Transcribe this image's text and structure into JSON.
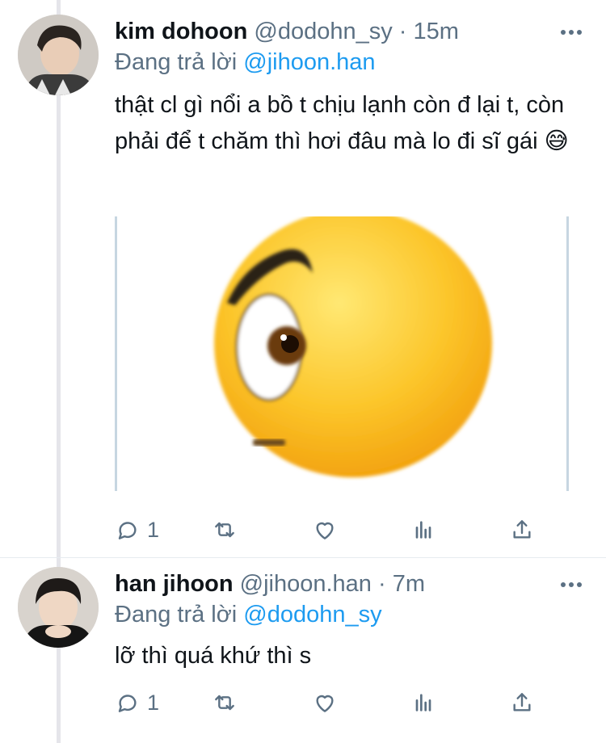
{
  "tweets": [
    {
      "author_name": "kim dohoon",
      "handle": "@dodohn_sy",
      "separator": "·",
      "time": "15m",
      "reply_prefix": "Đang trả lời",
      "reply_to": "@jihoon.han",
      "text": "thật cl gì nổi a bồ t chịu lạnh còn đ lại t, còn phải để t chăm thì hơi đâu mà lo đi sĩ gái 😅",
      "media": "eyebrow-raised-emoji-image",
      "reply_count": "1"
    },
    {
      "author_name": "han jihoon",
      "handle": "@jihoon.han",
      "separator": "·",
      "time": "7m",
      "reply_prefix": "Đang trả lời",
      "reply_to": "@dodohn_sy",
      "text": "lỡ thì quá khứ thì s",
      "reply_count": "1"
    }
  ],
  "icons": [
    "reply-icon",
    "retweet-icon",
    "like-icon",
    "analytics-icon",
    "share-icon",
    "more-icon"
  ],
  "colors": {
    "link": "#1d9bf0",
    "secondary": "#5b7083",
    "thread_line": "#e5e5ea"
  }
}
